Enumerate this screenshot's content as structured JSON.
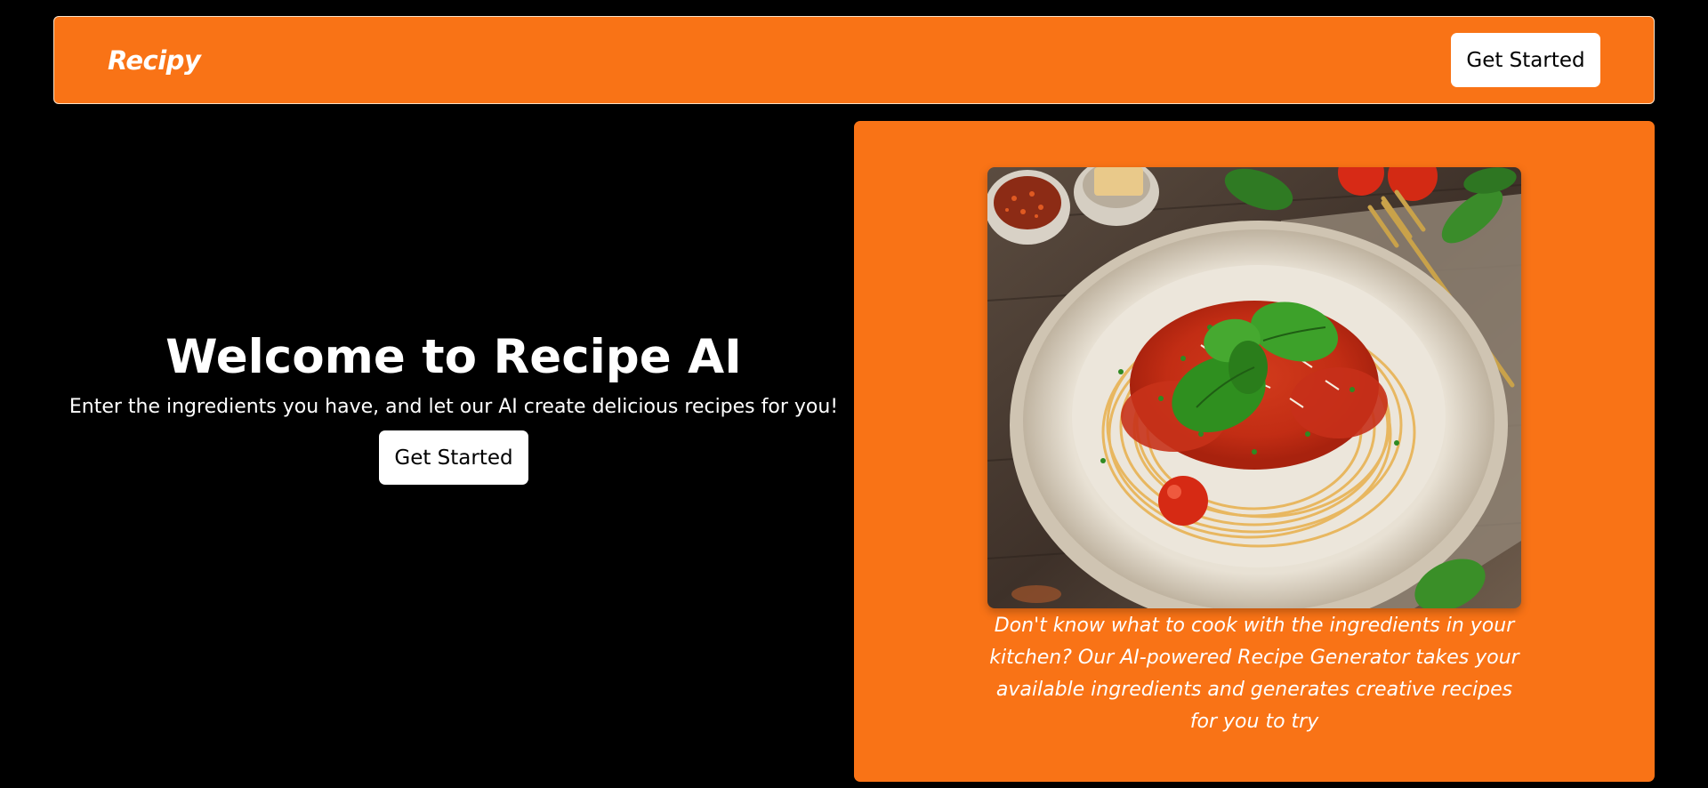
{
  "navbar": {
    "brand": "Recipy",
    "cta_label": "Get Started"
  },
  "hero": {
    "title": "Welcome to Recipe AI",
    "subtitle": "Enter the ingredients you have, and let our AI create delicious recipes for you!",
    "cta_label": "Get Started"
  },
  "card": {
    "image_name": "spaghetti-dish-image",
    "caption": "Don't know what to cook with the ingredients in your kitchen? Our AI-powered Recipe Generator takes your available ingredients and generates creative recipes for you to try"
  },
  "colors": {
    "page_background": "#000000",
    "accent_orange": "#f97316",
    "button_background": "#ffffff",
    "text_light": "#ffffff"
  }
}
